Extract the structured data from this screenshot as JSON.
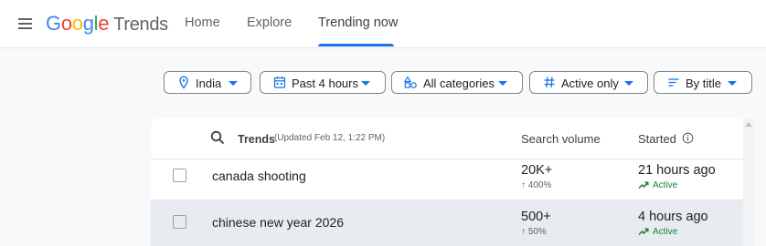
{
  "app": {
    "logo_letters": [
      {
        "char": "G",
        "color": "#4285F4"
      },
      {
        "char": "o",
        "color": "#EA4335"
      },
      {
        "char": "o",
        "color": "#FBBC05"
      },
      {
        "char": "g",
        "color": "#4285F4"
      },
      {
        "char": "l",
        "color": "#34A853"
      },
      {
        "char": "e",
        "color": "#EA4335"
      }
    ],
    "product_name": "Trends"
  },
  "nav": {
    "tabs": [
      {
        "label": "Home",
        "active": false
      },
      {
        "label": "Explore",
        "active": false
      },
      {
        "label": "Trending now",
        "active": true
      }
    ],
    "accent_color": "#1a73e8"
  },
  "filters": [
    {
      "label": "India",
      "icon": "location-pin-icon"
    },
    {
      "label": "Past 4 hours",
      "icon": "calendar-icon"
    },
    {
      "label": "All categories",
      "icon": "categories-icon"
    },
    {
      "label": "Active only",
      "icon": "hashtag-icon"
    },
    {
      "label": "By title",
      "icon": "sort-icon"
    }
  ],
  "table": {
    "headers": {
      "trends": "Trends",
      "updated": "(Updated Feb 12, 1:22 PM)",
      "search_volume": "Search volume",
      "started": "Started"
    },
    "rows": [
      {
        "title": "canada shooting",
        "volume": "20K+",
        "growth": "↑ 400%",
        "started": "21 hours ago",
        "status": "Active"
      },
      {
        "title": "chinese new year 2026",
        "volume": "500+",
        "growth": "↑ 50%",
        "started": "4 hours ago",
        "status": "Active"
      }
    ]
  },
  "colors": {
    "active_status": "#188038",
    "row_highlight": "#e8ecf1"
  }
}
